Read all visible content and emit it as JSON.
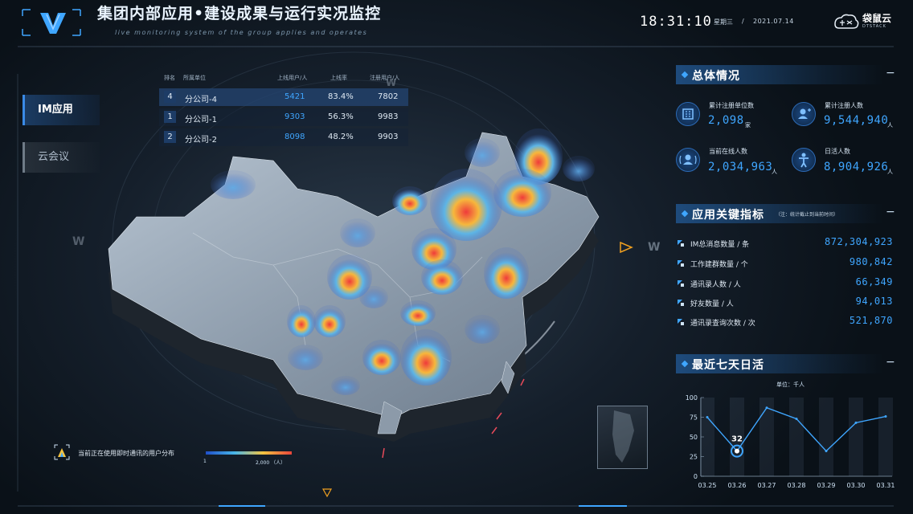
{
  "header": {
    "title": "集团内部应用•建设成果与运行实况监控",
    "subtitle": "live monitoring system of the group applies and operates",
    "time": "18:31:10",
    "weekday": "星期三",
    "date_sep": "/",
    "date": "2021.07.14",
    "brand_name": "袋鼠云",
    "brand_sub": "DTSTACK"
  },
  "nav": {
    "items": [
      {
        "label": "IM应用",
        "active": true
      },
      {
        "label": "云会议",
        "active": false
      }
    ]
  },
  "ranking": {
    "headers": [
      "排名",
      "所属单位",
      "上线用户/人",
      "上线率",
      "注册用户/人"
    ],
    "rows": [
      {
        "rank": "4",
        "unit": "分公司-4",
        "online_users": "5421",
        "online_rate": "83.4%",
        "registered": "7802"
      },
      {
        "rank": "1",
        "unit": "分公司-1",
        "online_users": "9303",
        "online_rate": "56.3%",
        "registered": "9983"
      },
      {
        "rank": "2",
        "unit": "分公司-2",
        "online_users": "8098",
        "online_rate": "48.2%",
        "registered": "9903"
      }
    ]
  },
  "map_legend": {
    "label": "当前正在使用即时通讯的用户分布",
    "min": "1",
    "max": "2,000 （人）",
    "colors": [
      "#1f4fc8",
      "#47b5e8",
      "#f4c441",
      "#e8453a"
    ]
  },
  "overview": {
    "title": "总体情况",
    "stats": [
      {
        "label": "累计注册单位数",
        "value": "2,098",
        "unit": "家",
        "icon": "building-icon"
      },
      {
        "label": "累计注册人数",
        "value": "9,544,940",
        "unit": "人",
        "icon": "user-add-icon"
      },
      {
        "label": "当前在线人数",
        "value": "2,034,963",
        "unit": "人",
        "icon": "online-users-icon"
      },
      {
        "label": "日活人数",
        "value": "8,904,926",
        "unit": "人",
        "icon": "person-icon"
      }
    ]
  },
  "kpi": {
    "title": "应用关键指标",
    "note": "（注：统计截止到当前时间）",
    "items": [
      {
        "label": "IM总消息数量 / 条",
        "value": "872,304,923"
      },
      {
        "label": "工作建群数量 / 个",
        "value": "980,842"
      },
      {
        "label": "通讯录人数 / 人",
        "value": "66,349"
      },
      {
        "label": "好友数量 / 人",
        "value": "94,013"
      },
      {
        "label": "通讯录查询次数 / 次",
        "value": "521,870"
      }
    ]
  },
  "daily": {
    "title": "最近七天日活",
    "unit_label": "单位：千人"
  },
  "chart_data": {
    "type": "line",
    "title": "最近七天日活",
    "x": [
      "03.25",
      "03.26",
      "03.27",
      "03.28",
      "03.29",
      "03.30",
      "03.31"
    ],
    "y_ticks": [
      "0",
      "25",
      "50",
      "75",
      "100"
    ],
    "ylim": [
      0,
      100
    ],
    "series": [
      {
        "values": [
          75,
          32,
          87,
          73,
          32,
          68,
          76
        ]
      }
    ],
    "highlight": {
      "index": 1,
      "label": "32"
    },
    "accent": "#3fa6ff"
  }
}
